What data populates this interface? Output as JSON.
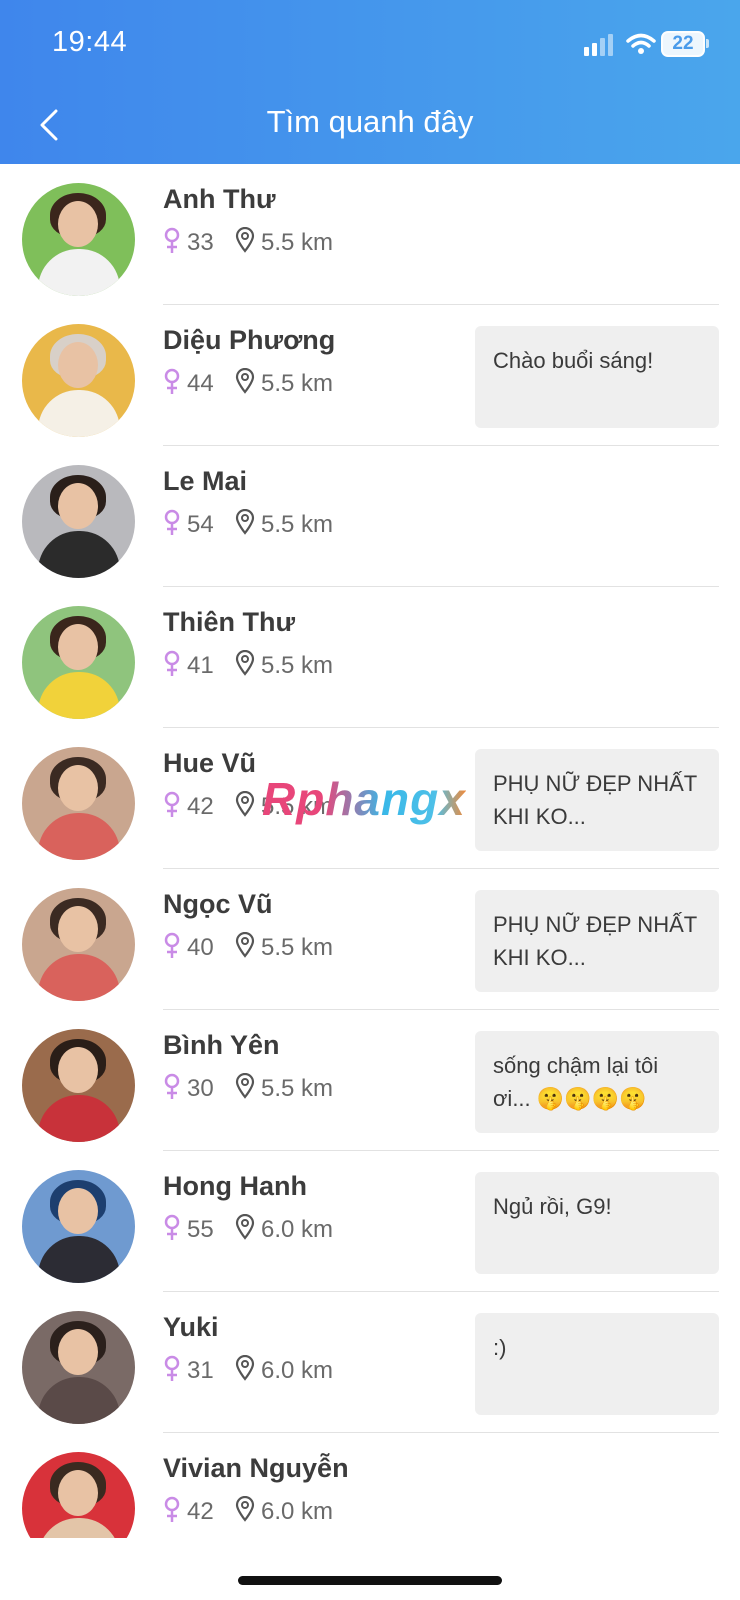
{
  "status_bar": {
    "time": "19:44",
    "battery": "22"
  },
  "header": {
    "title": "Tìm quanh đây",
    "back_icon": "chevron-left-icon"
  },
  "icons": {
    "gender": "female-icon",
    "location": "map-pin-icon"
  },
  "colors": {
    "header_start": "#3f86ec",
    "header_end": "#4aa6ec",
    "female_symbol": "#c98be6",
    "bubble_bg": "#efefef",
    "name_text": "#3c3c3c"
  },
  "watermark": "Rphangx",
  "users": [
    {
      "name": "Anh Thư",
      "age": "33",
      "distance": "5.5 km",
      "status": "",
      "avatar_bg": "#7fbf5a",
      "body": "#f2f2f2",
      "hair": "#3b261c"
    },
    {
      "name": "Diệu Phương",
      "age": "44",
      "distance": "5.5 km",
      "status": "Chào buổi sáng!",
      "avatar_bg": "#e9b84a",
      "body": "#f5f0e6",
      "hair": "#d8d0c8"
    },
    {
      "name": "Le Mai",
      "age": "54",
      "distance": "5.5 km",
      "status": "",
      "avatar_bg": "#b9b9bd",
      "body": "#2b2b2b",
      "hair": "#2a1f1a"
    },
    {
      "name": "Thiên Thư",
      "age": "41",
      "distance": "5.5 km",
      "status": "",
      "avatar_bg": "#8fc47d",
      "body": "#f1d23a",
      "hair": "#3a261c"
    },
    {
      "name": "Hue Vũ",
      "age": "42",
      "distance": "5.5 km",
      "status": "PHỤ NỮ ĐẸP NHẤT KHI KO...",
      "avatar_bg": "#c9a68f",
      "body": "#d9625c",
      "hair": "#3b2a22"
    },
    {
      "name": "Ngọc Vũ",
      "age": "40",
      "distance": "5.5 km",
      "status": "PHỤ NỮ ĐẸP NHẤT KHI KO...",
      "avatar_bg": "#c9a68f",
      "body": "#d9625c",
      "hair": "#3b2a22"
    },
    {
      "name": "Bình Yên",
      "age": "30",
      "distance": "5.5 km",
      "status": "sống chậm lại tôi ơi... 🤫🤫🤫🤫",
      "avatar_bg": "#9a6b4c",
      "body": "#c8323a",
      "hair": "#2a1e18"
    },
    {
      "name": "Hong Hanh",
      "age": "55",
      "distance": "6.0 km",
      "status": "Ngủ rồi, G9!",
      "avatar_bg": "#6f9ad0",
      "body": "#2c2c34",
      "hair": "#1d3f6f"
    },
    {
      "name": "Yuki",
      "age": "31",
      "distance": "6.0 km",
      "status": ":)",
      "avatar_bg": "#7a6a66",
      "body": "#5a4a48",
      "hair": "#2b201c"
    },
    {
      "name": "Vivian Nguyễn",
      "age": "42",
      "distance": "6.0 km",
      "status": "",
      "avatar_bg": "#d8323a",
      "body": "#e3c5a8",
      "hair": "#3a2a20"
    }
  ]
}
